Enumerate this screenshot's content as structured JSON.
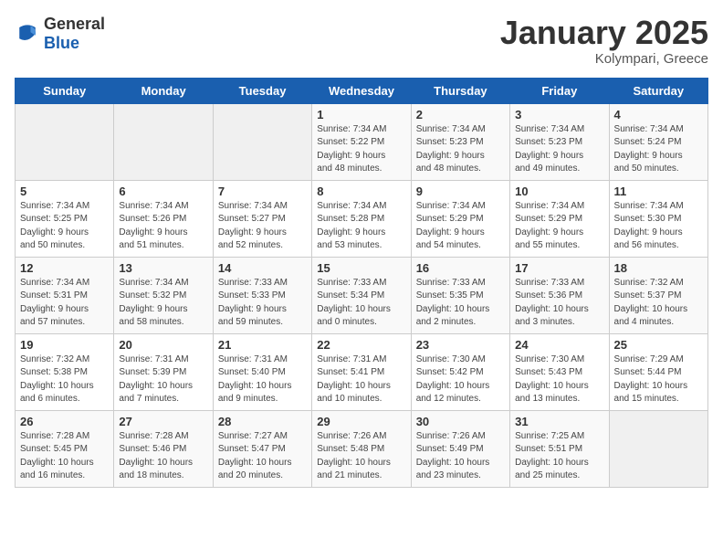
{
  "logo": {
    "general": "General",
    "blue": "Blue"
  },
  "title": "January 2025",
  "subtitle": "Kolympari, Greece",
  "days_of_week": [
    "Sunday",
    "Monday",
    "Tuesday",
    "Wednesday",
    "Thursday",
    "Friday",
    "Saturday"
  ],
  "weeks": [
    [
      {
        "day": "",
        "info": ""
      },
      {
        "day": "",
        "info": ""
      },
      {
        "day": "",
        "info": ""
      },
      {
        "day": "1",
        "info": "Sunrise: 7:34 AM\nSunset: 5:22 PM\nDaylight: 9 hours\nand 48 minutes."
      },
      {
        "day": "2",
        "info": "Sunrise: 7:34 AM\nSunset: 5:23 PM\nDaylight: 9 hours\nand 48 minutes."
      },
      {
        "day": "3",
        "info": "Sunrise: 7:34 AM\nSunset: 5:23 PM\nDaylight: 9 hours\nand 49 minutes."
      },
      {
        "day": "4",
        "info": "Sunrise: 7:34 AM\nSunset: 5:24 PM\nDaylight: 9 hours\nand 50 minutes."
      }
    ],
    [
      {
        "day": "5",
        "info": "Sunrise: 7:34 AM\nSunset: 5:25 PM\nDaylight: 9 hours\nand 50 minutes."
      },
      {
        "day": "6",
        "info": "Sunrise: 7:34 AM\nSunset: 5:26 PM\nDaylight: 9 hours\nand 51 minutes."
      },
      {
        "day": "7",
        "info": "Sunrise: 7:34 AM\nSunset: 5:27 PM\nDaylight: 9 hours\nand 52 minutes."
      },
      {
        "day": "8",
        "info": "Sunrise: 7:34 AM\nSunset: 5:28 PM\nDaylight: 9 hours\nand 53 minutes."
      },
      {
        "day": "9",
        "info": "Sunrise: 7:34 AM\nSunset: 5:29 PM\nDaylight: 9 hours\nand 54 minutes."
      },
      {
        "day": "10",
        "info": "Sunrise: 7:34 AM\nSunset: 5:29 PM\nDaylight: 9 hours\nand 55 minutes."
      },
      {
        "day": "11",
        "info": "Sunrise: 7:34 AM\nSunset: 5:30 PM\nDaylight: 9 hours\nand 56 minutes."
      }
    ],
    [
      {
        "day": "12",
        "info": "Sunrise: 7:34 AM\nSunset: 5:31 PM\nDaylight: 9 hours\nand 57 minutes."
      },
      {
        "day": "13",
        "info": "Sunrise: 7:34 AM\nSunset: 5:32 PM\nDaylight: 9 hours\nand 58 minutes."
      },
      {
        "day": "14",
        "info": "Sunrise: 7:33 AM\nSunset: 5:33 PM\nDaylight: 9 hours\nand 59 minutes."
      },
      {
        "day": "15",
        "info": "Sunrise: 7:33 AM\nSunset: 5:34 PM\nDaylight: 10 hours\nand 0 minutes."
      },
      {
        "day": "16",
        "info": "Sunrise: 7:33 AM\nSunset: 5:35 PM\nDaylight: 10 hours\nand 2 minutes."
      },
      {
        "day": "17",
        "info": "Sunrise: 7:33 AM\nSunset: 5:36 PM\nDaylight: 10 hours\nand 3 minutes."
      },
      {
        "day": "18",
        "info": "Sunrise: 7:32 AM\nSunset: 5:37 PM\nDaylight: 10 hours\nand 4 minutes."
      }
    ],
    [
      {
        "day": "19",
        "info": "Sunrise: 7:32 AM\nSunset: 5:38 PM\nDaylight: 10 hours\nand 6 minutes."
      },
      {
        "day": "20",
        "info": "Sunrise: 7:31 AM\nSunset: 5:39 PM\nDaylight: 10 hours\nand 7 minutes."
      },
      {
        "day": "21",
        "info": "Sunrise: 7:31 AM\nSunset: 5:40 PM\nDaylight: 10 hours\nand 9 minutes."
      },
      {
        "day": "22",
        "info": "Sunrise: 7:31 AM\nSunset: 5:41 PM\nDaylight: 10 hours\nand 10 minutes."
      },
      {
        "day": "23",
        "info": "Sunrise: 7:30 AM\nSunset: 5:42 PM\nDaylight: 10 hours\nand 12 minutes."
      },
      {
        "day": "24",
        "info": "Sunrise: 7:30 AM\nSunset: 5:43 PM\nDaylight: 10 hours\nand 13 minutes."
      },
      {
        "day": "25",
        "info": "Sunrise: 7:29 AM\nSunset: 5:44 PM\nDaylight: 10 hours\nand 15 minutes."
      }
    ],
    [
      {
        "day": "26",
        "info": "Sunrise: 7:28 AM\nSunset: 5:45 PM\nDaylight: 10 hours\nand 16 minutes."
      },
      {
        "day": "27",
        "info": "Sunrise: 7:28 AM\nSunset: 5:46 PM\nDaylight: 10 hours\nand 18 minutes."
      },
      {
        "day": "28",
        "info": "Sunrise: 7:27 AM\nSunset: 5:47 PM\nDaylight: 10 hours\nand 20 minutes."
      },
      {
        "day": "29",
        "info": "Sunrise: 7:26 AM\nSunset: 5:48 PM\nDaylight: 10 hours\nand 21 minutes."
      },
      {
        "day": "30",
        "info": "Sunrise: 7:26 AM\nSunset: 5:49 PM\nDaylight: 10 hours\nand 23 minutes."
      },
      {
        "day": "31",
        "info": "Sunrise: 7:25 AM\nSunset: 5:51 PM\nDaylight: 10 hours\nand 25 minutes."
      },
      {
        "day": "",
        "info": ""
      }
    ]
  ]
}
